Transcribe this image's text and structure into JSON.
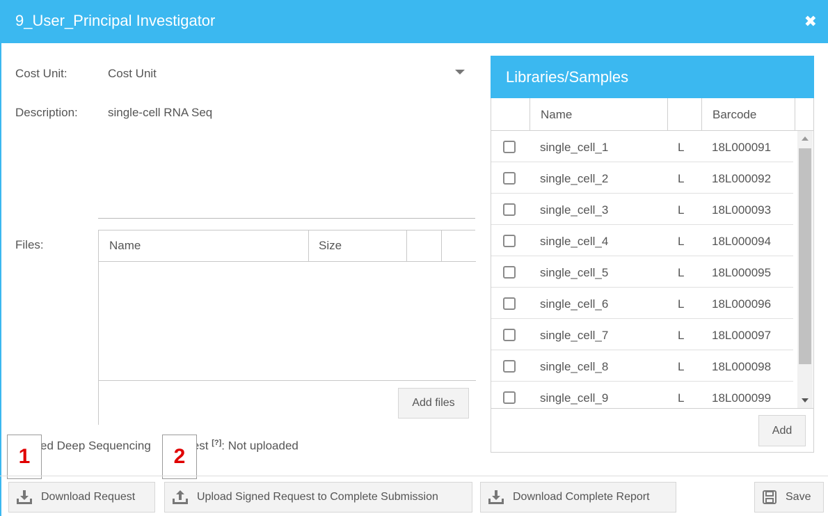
{
  "window": {
    "title": "9_User_Principal Investigator",
    "close_glyph": "✖"
  },
  "form": {
    "cost_unit_label": "Cost Unit:",
    "cost_unit_value": "Cost Unit",
    "description_label": "Description:",
    "description_value": "single-cell RNA Seq",
    "files_label": "Files:",
    "files_columns": [
      "Name",
      "Size"
    ],
    "add_files_label": "Add files"
  },
  "libraries": {
    "title": "Libraries/Samples",
    "columns": [
      "Name",
      "Barcode"
    ],
    "rows": [
      {
        "name": "single_cell_1",
        "type": "L",
        "barcode": "18L000091"
      },
      {
        "name": "single_cell_2",
        "type": "L",
        "barcode": "18L000092"
      },
      {
        "name": "single_cell_3",
        "type": "L",
        "barcode": "18L000093"
      },
      {
        "name": "single_cell_4",
        "type": "L",
        "barcode": "18L000094"
      },
      {
        "name": "single_cell_5",
        "type": "L",
        "barcode": "18L000095"
      },
      {
        "name": "single_cell_6",
        "type": "L",
        "barcode": "18L000096"
      },
      {
        "name": "single_cell_7",
        "type": "L",
        "barcode": "18L000097"
      },
      {
        "name": "single_cell_8",
        "type": "L",
        "barcode": "18L000098"
      },
      {
        "name": "single_cell_9",
        "type": "L",
        "barcode": "18L000099"
      }
    ],
    "add_label": "Add"
  },
  "status": {
    "text_part1": "ed Deep Sequencing",
    "text_part2": "est",
    "help": "[?]",
    "suffix": ": Not uploaded"
  },
  "markers": [
    "1",
    "2"
  ],
  "toolbar": {
    "download_request": "Download Request",
    "upload_signed": "Upload Signed Request to Complete Submission",
    "download_report": "Download Complete Report",
    "save": "Save"
  },
  "colors": {
    "accent": "#3bb8f0",
    "marker_text": "#e00000"
  },
  "icons": [
    "close-icon",
    "dropdown-caret-icon",
    "download-icon",
    "upload-icon",
    "save-icon"
  ]
}
